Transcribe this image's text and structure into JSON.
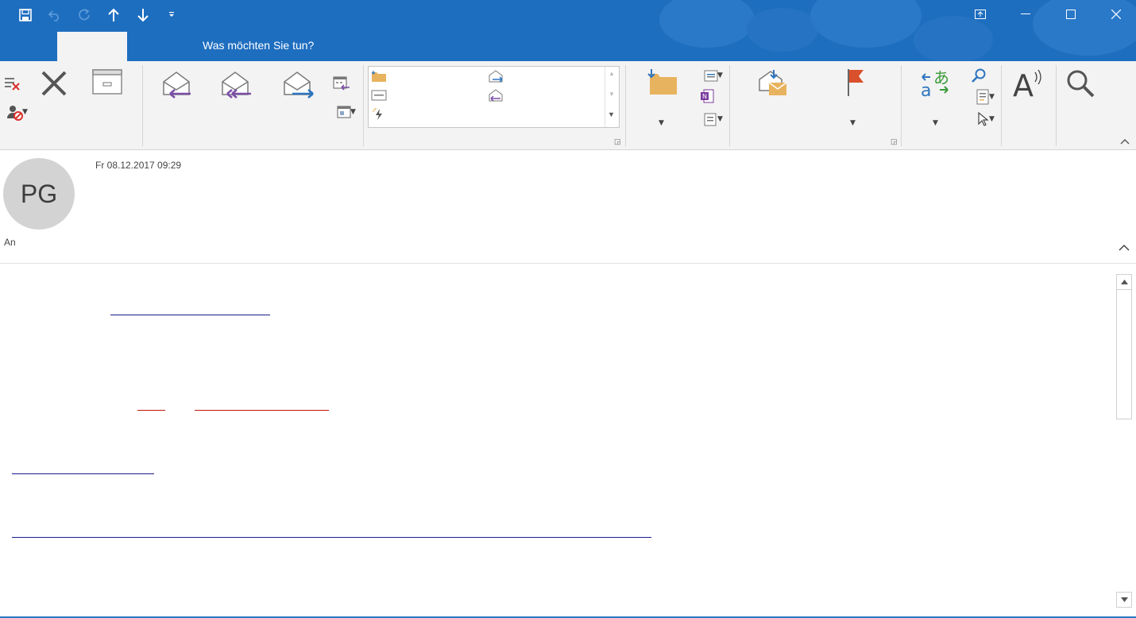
{
  "titlebar": {
    "search_placeholder": "Was möchten Sie tun?",
    "active_tab_label": "",
    "qat": {
      "save_icon": "save-icon",
      "undo_icon": "undo-icon",
      "redo_icon": "redo-icon",
      "previous_icon": "arrow-up-icon",
      "next_icon": "arrow-down-icon",
      "customize_icon": "customize-qat-icon"
    },
    "window_controls": [
      "ribbon-display-options-icon",
      "minimize-icon",
      "maximize-icon",
      "close-icon"
    ],
    "colors": {
      "accent": "#1e6ec0",
      "ribbon": "#f3f3f3"
    }
  },
  "ribbon": {
    "groups": [
      {
        "name": "delete",
        "items": [
          "ignore-icon",
          "junk-icon",
          "delete-icon",
          "archive-icon"
        ]
      },
      {
        "name": "respond",
        "items": [
          "reply-icon",
          "reply-all-icon",
          "forward-icon",
          "meeting-icon",
          "more-respond-icon"
        ]
      },
      {
        "name": "quick-steps",
        "items": [
          "folder-icon",
          "forward-step-icon",
          "email-step-icon",
          "reply-delete-icon",
          "create-new-icon"
        ]
      },
      {
        "name": "move",
        "items": [
          "move-icon",
          "rules-icon",
          "onenote-icon",
          "actions-icon"
        ]
      },
      {
        "name": "tags",
        "items": [
          "mark-unread-icon",
          "follow-up-flag-icon"
        ]
      },
      {
        "name": "editing",
        "items": [
          "translate-icon",
          "find-icon",
          "related-icon",
          "select-icon"
        ]
      },
      {
        "name": "speech",
        "items": [
          "read-aloud-icon"
        ]
      },
      {
        "name": "zoom",
        "items": [
          "zoom-icon"
        ]
      }
    ]
  },
  "message": {
    "avatar_initials": "PG",
    "datetime": "Fr 08.12.2017 09:29",
    "to_label": "An"
  }
}
